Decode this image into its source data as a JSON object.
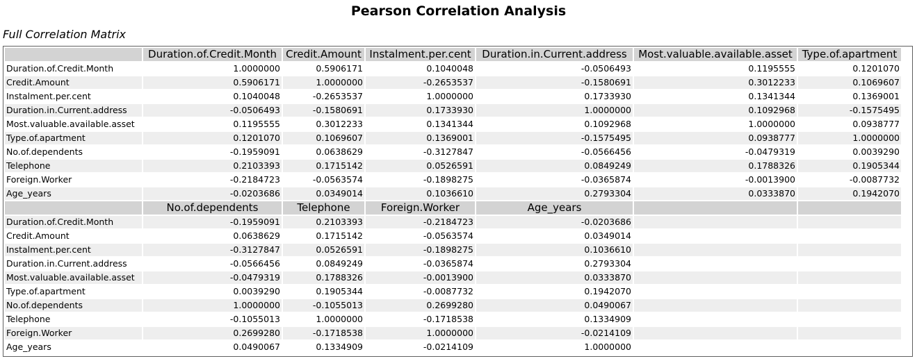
{
  "page": {
    "title": "Pearson Correlation Analysis",
    "subtitle": "Full Correlation Matrix"
  },
  "table1": {
    "headers": [
      "",
      "Duration.of.Credit.Month",
      "Credit.Amount",
      "Instalment.per.cent",
      "Duration.in.Current.address",
      "Most.valuable.available.asset",
      "Type.of.apartment"
    ],
    "rows": [
      [
        "Duration.of.Credit.Month",
        "1.0000000",
        "0.5906171",
        "0.1040048",
        "-0.0506493",
        "0.1195555",
        "0.1201070"
      ],
      [
        "Credit.Amount",
        "0.5906171",
        "1.0000000",
        "-0.2653537",
        "-0.1580691",
        "0.3012233",
        "0.1069607"
      ],
      [
        "Instalment.per.cent",
        "0.1040048",
        "-0.2653537",
        "1.0000000",
        "0.1733930",
        "0.1341344",
        "0.1369001"
      ],
      [
        "Duration.in.Current.address",
        "-0.0506493",
        "-0.1580691",
        "0.1733930",
        "1.0000000",
        "0.1092968",
        "-0.1575495"
      ],
      [
        "Most.valuable.available.asset",
        "0.1195555",
        "0.3012233",
        "0.1341344",
        "0.1092968",
        "1.0000000",
        "0.0938777"
      ],
      [
        "Type.of.apartment",
        "0.1201070",
        "0.1069607",
        "0.1369001",
        "-0.1575495",
        "0.0938777",
        "1.0000000"
      ],
      [
        "No.of.dependents",
        "-0.1959091",
        "0.0638629",
        "-0.3127847",
        "-0.0566456",
        "-0.0479319",
        "0.0039290"
      ],
      [
        "Telephone",
        "0.2103393",
        "0.1715142",
        "0.0526591",
        "0.0849249",
        "0.1788326",
        "0.1905344"
      ],
      [
        "Foreign.Worker",
        "-0.2184723",
        "-0.0563574",
        "-0.1898275",
        "-0.0365874",
        "-0.0013900",
        "-0.0087732"
      ],
      [
        "Age_years",
        "-0.0203686",
        "0.0349014",
        "0.1036610",
        "0.2793304",
        "0.0333870",
        "0.1942070"
      ]
    ]
  },
  "table2": {
    "headers": [
      "",
      "No.of.dependents",
      "Telephone",
      "Foreign.Worker",
      "Age_years",
      "",
      ""
    ],
    "rows": [
      [
        "Duration.of.Credit.Month",
        "-0.1959091",
        "0.2103393",
        "-0.2184723",
        "-0.0203686",
        "",
        ""
      ],
      [
        "Credit.Amount",
        "0.0638629",
        "0.1715142",
        "-0.0563574",
        "0.0349014",
        "",
        ""
      ],
      [
        "Instalment.per.cent",
        "-0.3127847",
        "0.0526591",
        "-0.1898275",
        "0.1036610",
        "",
        ""
      ],
      [
        "Duration.in.Current.address",
        "-0.0566456",
        "0.0849249",
        "-0.0365874",
        "0.2793304",
        "",
        ""
      ],
      [
        "Most.valuable.available.asset",
        "-0.0479319",
        "0.1788326",
        "-0.0013900",
        "0.0333870",
        "",
        ""
      ],
      [
        "Type.of.apartment",
        "0.0039290",
        "0.1905344",
        "-0.0087732",
        "0.1942070",
        "",
        ""
      ],
      [
        "No.of.dependents",
        "1.0000000",
        "-0.1055013",
        "0.2699280",
        "0.0490067",
        "",
        ""
      ],
      [
        "Telephone",
        "-0.1055013",
        "1.0000000",
        "-0.1718538",
        "0.1334909",
        "",
        ""
      ],
      [
        "Foreign.Worker",
        "0.2699280",
        "-0.1718538",
        "1.0000000",
        "-0.0214109",
        "",
        ""
      ],
      [
        "Age_years",
        "0.0490067",
        "0.1334909",
        "-0.0214109",
        "1.0000000",
        "",
        ""
      ]
    ]
  }
}
